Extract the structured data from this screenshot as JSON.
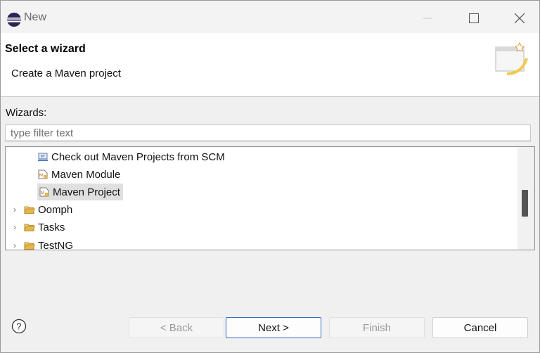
{
  "window": {
    "title": "New"
  },
  "header": {
    "title": "Select a wizard",
    "description": "Create a Maven project"
  },
  "wizards_label": "Wizards:",
  "filter": {
    "placeholder": "type filter text",
    "value": ""
  },
  "tree": {
    "items": [
      {
        "label": "Check out Maven Projects from SCM",
        "icon": "checkout-icon",
        "expander": "",
        "selected": false
      },
      {
        "label": "Maven Module",
        "icon": "maven-module-icon",
        "expander": "",
        "selected": false
      },
      {
        "label": "Maven Project",
        "icon": "maven-project-icon",
        "expander": "",
        "selected": true
      },
      {
        "label": "Oomph",
        "icon": "folder-icon",
        "expander": "›",
        "selected": false
      },
      {
        "label": "Tasks",
        "icon": "folder-icon",
        "expander": "›",
        "selected": false
      },
      {
        "label": "TestNG",
        "icon": "folder-icon",
        "expander": "›",
        "selected": false
      }
    ]
  },
  "buttons": {
    "help": "?",
    "back": "< Back",
    "next": "Next >",
    "finish": "Finish",
    "cancel": "Cancel"
  },
  "colors": {
    "accent": "#2e6dc4",
    "selected_row": "#e0e0e0",
    "folder": "#e8b64c"
  }
}
